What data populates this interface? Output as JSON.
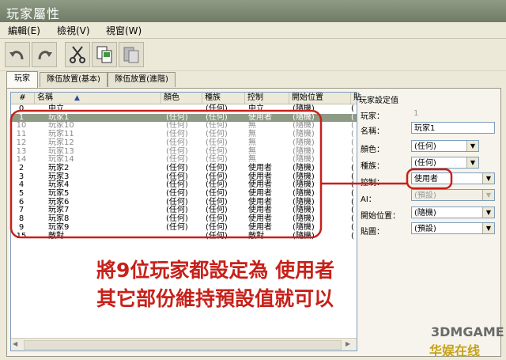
{
  "window": {
    "title": "玩家屬性"
  },
  "menu": [
    {
      "label": "編輯(E)"
    },
    {
      "label": "檢視(V)"
    },
    {
      "label": "視窗(W)"
    }
  ],
  "toolbar": {
    "buttons": [
      {
        "icon": "undo-icon"
      },
      {
        "icon": "redo-icon"
      },
      {
        "icon": "cut-icon"
      },
      {
        "icon": "copy-icon"
      },
      {
        "icon": "paste-icon"
      }
    ]
  },
  "tabs": [
    {
      "label": "玩家",
      "active": true
    },
    {
      "label": "隊伍放置(基本)",
      "active": false
    },
    {
      "label": "隊伍放置(進階)",
      "active": false
    }
  ],
  "list": {
    "columns": [
      "#",
      "名稱",
      "顏色",
      "種族",
      "控制",
      "開始位置",
      "貼"
    ],
    "rows": [
      {
        "num": "0",
        "name": "中立",
        "color": "",
        "race": "(任何)",
        "control": "中立",
        "start": "(隨機)",
        "style": "normal"
      },
      {
        "num": "1",
        "name": "玩家1",
        "color": "(任何)",
        "race": "(任何)",
        "control": "使用者",
        "start": "(隨機)",
        "style": "sel"
      },
      {
        "num": "10",
        "name": "玩家10",
        "color": "(任何)",
        "race": "(任何)",
        "control": "無",
        "start": "(隨機)",
        "style": "gray"
      },
      {
        "num": "11",
        "name": "玩家11",
        "color": "(任何)",
        "race": "(任何)",
        "control": "無",
        "start": "(隨機)",
        "style": "gray"
      },
      {
        "num": "12",
        "name": "玩家12",
        "color": "(任何)",
        "race": "(任何)",
        "control": "無",
        "start": "(隨機)",
        "style": "gray"
      },
      {
        "num": "13",
        "name": "玩家13",
        "color": "(任何)",
        "race": "(任何)",
        "control": "無",
        "start": "(隨機)",
        "style": "gray"
      },
      {
        "num": "14",
        "name": "玩家14",
        "color": "(任何)",
        "race": "(任何)",
        "control": "無",
        "start": "(隨機)",
        "style": "gray"
      },
      {
        "num": "2",
        "name": "玩家2",
        "color": "(任何)",
        "race": "(任何)",
        "control": "使用者",
        "start": "(隨機)",
        "style": "normal"
      },
      {
        "num": "3",
        "name": "玩家3",
        "color": "(任何)",
        "race": "(任何)",
        "control": "使用者",
        "start": "(隨機)",
        "style": "normal"
      },
      {
        "num": "4",
        "name": "玩家4",
        "color": "(任何)",
        "race": "(任何)",
        "control": "使用者",
        "start": "(隨機)",
        "style": "normal"
      },
      {
        "num": "5",
        "name": "玩家5",
        "color": "(任何)",
        "race": "(任何)",
        "control": "使用者",
        "start": "(隨機)",
        "style": "normal"
      },
      {
        "num": "6",
        "name": "玩家6",
        "color": "(任何)",
        "race": "(任何)",
        "control": "使用者",
        "start": "(隨機)",
        "style": "normal"
      },
      {
        "num": "7",
        "name": "玩家7",
        "color": "(任何)",
        "race": "(任何)",
        "control": "使用者",
        "start": "(隨機)",
        "style": "normal"
      },
      {
        "num": "8",
        "name": "玩家8",
        "color": "(任何)",
        "race": "(任何)",
        "control": "使用者",
        "start": "(隨機)",
        "style": "normal"
      },
      {
        "num": "9",
        "name": "玩家9",
        "color": "(任何)",
        "race": "(任何)",
        "control": "使用者",
        "start": "(隨機)",
        "style": "normal"
      },
      {
        "num": "15",
        "name": "敵對",
        "color": "",
        "race": "(任何)",
        "control": "敵對",
        "start": "(隨機)",
        "style": "normal"
      }
    ]
  },
  "settings": {
    "heading": "玩家設定值",
    "player_label": "玩家：",
    "player_value": "1",
    "name_label": "名稱：",
    "name_value": "玩家1",
    "color_label": "顏色：",
    "color_value": "(任何)",
    "race_label": "種族：",
    "race_value": "(任何)",
    "control_label": "控制：",
    "control_value": "使用者",
    "ai_label": "AI：",
    "ai_value": "(預設)",
    "start_label": "開始位置：",
    "start_value": "(隨機)",
    "map_label": "貼圖：",
    "map_value": "(預設)"
  },
  "annotation": {
    "line1_part1": "將",
    "line1_number": "9",
    "line1_part2": "位玩家都設定為 使用者",
    "line2": "其它部份維持預設值就可以",
    "color": "#c7211a"
  },
  "watermark": {
    "line1": "3DMGAME",
    "line2": "华娱在线"
  }
}
